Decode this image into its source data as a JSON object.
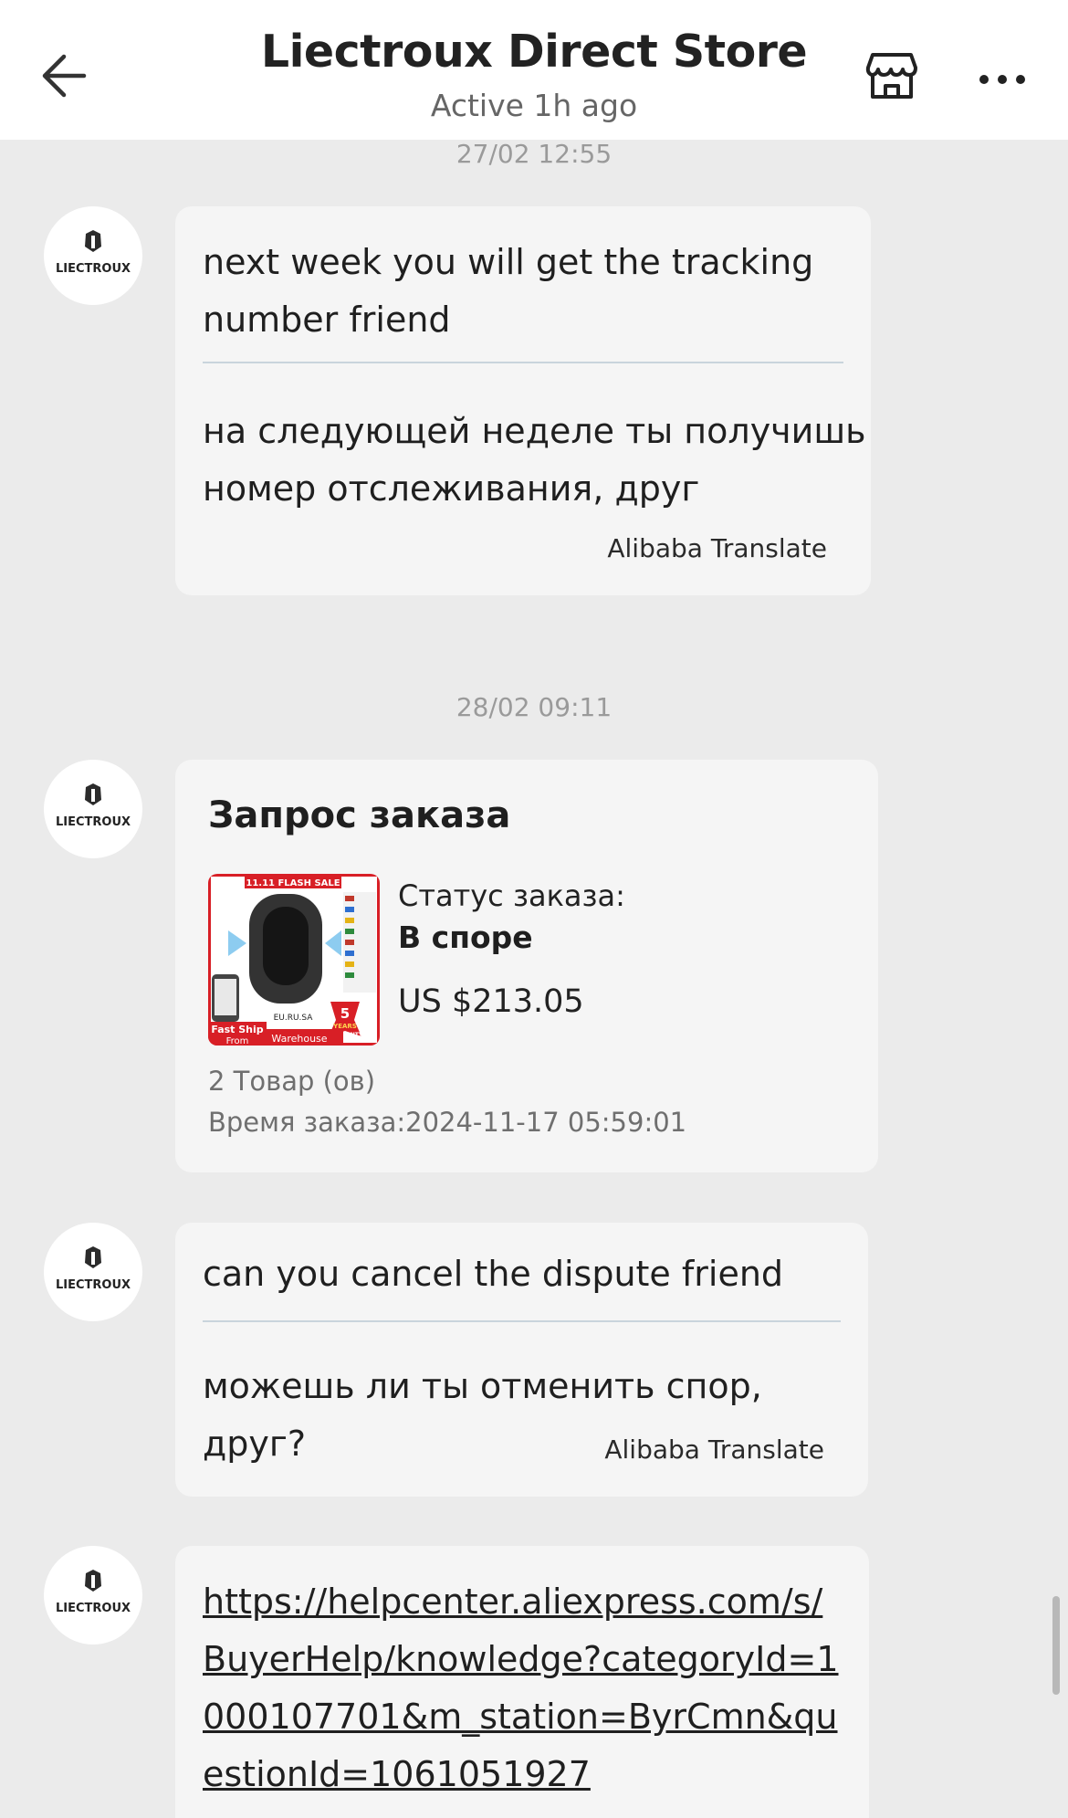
{
  "header": {
    "title": "Liectroux Direct Store",
    "status": "Active 1h ago",
    "back_icon": "arrow-left-icon",
    "store_icon": "store-icon",
    "more_icon": "more-horizontal-icon"
  },
  "avatar_brand": "LIECTROUX",
  "messages": [
    {
      "timestamp": "27/02 12:55",
      "original_lines": [
        "next week you will get the tracking",
        "number friend"
      ],
      "translated_lines": [
        "на следующей неделе ты получишь",
        "номер отслеживания, друг"
      ],
      "translate_label": "Alibaba Translate"
    },
    {
      "timestamp": "28/02 09:11",
      "order_card": {
        "title": "Запрос заказа",
        "status_label": "Статус заказа:",
        "status_value": "В споре",
        "price": "US $213.05",
        "item_count": "2 Товар (ов)",
        "order_time": "Время заказа:2024-11-17 05:59:01",
        "image_texts": {
          "banner": "11.11 FLASH SALE",
          "ship": "Fast Ship",
          "from": "From",
          "warehouse": "Warehouse",
          "regions": "EU.RU.SA",
          "warranty_years": "5",
          "warranty_unit": "YEARS",
          "warranty": "WARRANTY"
        }
      }
    },
    {
      "original_lines": [
        "can you cancel the dispute friend"
      ],
      "translated_lines": [
        "можешь ли ты отменить спор, друг?"
      ],
      "translate_label": "Alibaba Translate"
    },
    {
      "link_text": "https://helpcenter.aliexpress.com/s/BuyerHelp/knowledge?categoryId=1000107701&m_station=ByrCmn&questionId=1061051927"
    }
  ],
  "colors": {
    "background": "#ebebeb",
    "bubble": "#f5f5f5",
    "header": "#ffffff",
    "timestamp": "#9a9a9a",
    "divider": "#c9d4dc",
    "product_red": "#d81f26"
  }
}
